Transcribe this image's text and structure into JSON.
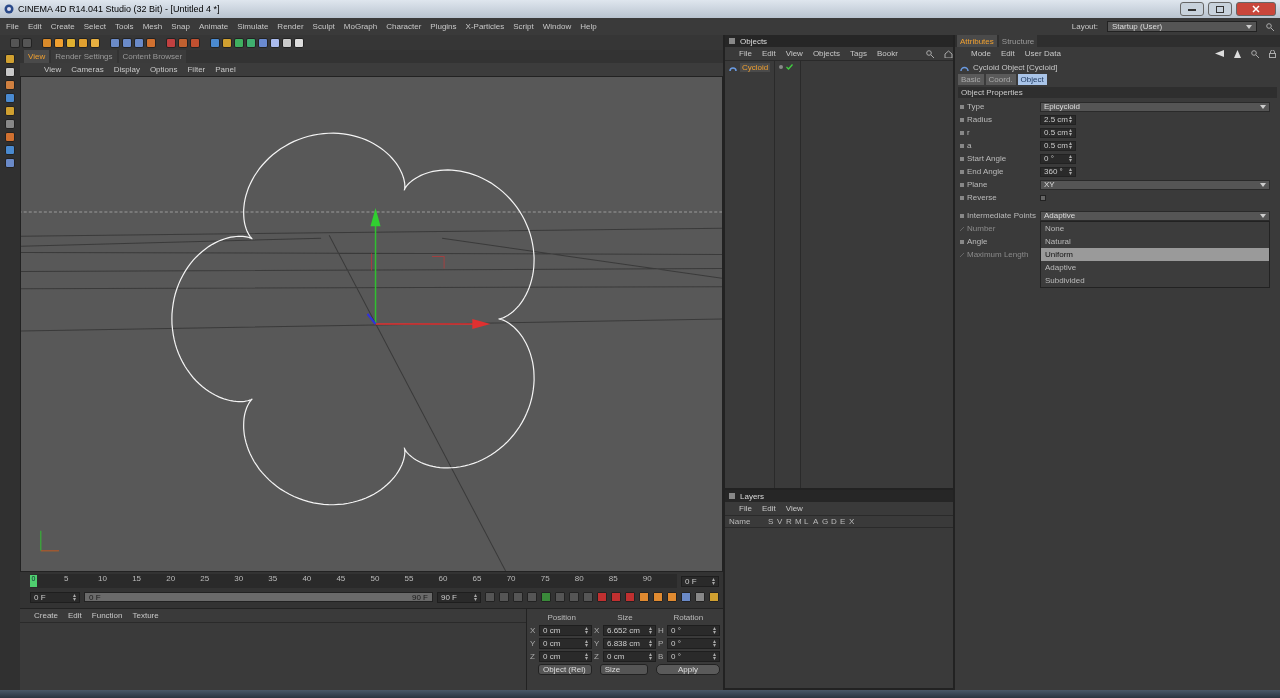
{
  "window": {
    "title": "CINEMA 4D R14.041 Studio (32 Bit) - [Untitled 4 *]"
  },
  "menu": [
    "File",
    "Edit",
    "Create",
    "Select",
    "Tools",
    "Mesh",
    "Snap",
    "Animate",
    "Simulate",
    "Render",
    "Sculpt",
    "MoGraph",
    "Character",
    "Plugins",
    "X-Particles",
    "Script",
    "Window",
    "Help"
  ],
  "layout": {
    "label": "Layout:",
    "value": "Startup (User)"
  },
  "viewport": {
    "tabs": [
      {
        "label": "View",
        "selected": true
      },
      {
        "label": "Render Settings",
        "selected": false
      },
      {
        "label": "Content Browser",
        "selected": false
      }
    ],
    "menu": [
      "View",
      "Cameras",
      "Display",
      "Options",
      "Filter",
      "Panel"
    ]
  },
  "timeline": {
    "playhead": {
      "label": "0",
      "level": 0
    },
    "ticks": [
      "5",
      "10",
      "15",
      "20",
      "25",
      "30",
      "35",
      "40",
      "45",
      "50",
      "55",
      "60",
      "65",
      "70",
      "75",
      "80",
      "85",
      "90"
    ],
    "current": "0 F",
    "start": "0 F",
    "range_start": "0 F",
    "range_end": "90 F",
    "end": "90 F"
  },
  "material_menu": [
    "Create",
    "Edit",
    "Function",
    "Texture"
  ],
  "coordinates": {
    "headers": [
      "Position",
      "Size",
      "Rotation"
    ],
    "rows": [
      {
        "axis": "X",
        "position": "0 cm",
        "size_axis": "X",
        "size": "6.652 cm",
        "rot_axis": "H",
        "rotation": "0 °"
      },
      {
        "axis": "Y",
        "position": "0 cm",
        "size_axis": "Y",
        "size": "6.838 cm",
        "rot_axis": "P",
        "rotation": "0 °"
      },
      {
        "axis": "Z",
        "position": "0 cm",
        "size_axis": "Z",
        "size": "0 cm",
        "rot_axis": "B",
        "rotation": "0 °"
      }
    ],
    "mode": "Object (Rel)",
    "size_mode": "Size",
    "apply": "Apply"
  },
  "objects": {
    "title": "Objects",
    "menu": [
      "File",
      "Edit",
      "View",
      "Objects",
      "Tags",
      "Bookr"
    ],
    "items": [
      {
        "name": "Cycloid",
        "selected": true
      }
    ]
  },
  "layers": {
    "title": "Layers",
    "menu": [
      "File",
      "Edit",
      "View"
    ],
    "columns": [
      "Name",
      "S",
      "V",
      "R",
      "M",
      "L",
      "A",
      "G",
      "D",
      "E",
      "X"
    ]
  },
  "attributes": {
    "tabs": [
      {
        "label": "Attributes",
        "selected": true
      },
      {
        "label": "Structure",
        "selected": false
      }
    ],
    "menu": [
      "Mode",
      "Edit",
      "User Data"
    ],
    "object_title": "Cycloid Object [Cycloid]",
    "subtabs": [
      {
        "label": "Basic",
        "selected": false
      },
      {
        "label": "Coord.",
        "selected": false
      },
      {
        "label": "Object",
        "selected": true
      }
    ],
    "section": "Object Properties",
    "properties": [
      {
        "label": "Type",
        "kind": "dropdown",
        "value": "Epicycloid",
        "disabled": false
      },
      {
        "label": "Radius",
        "kind": "number",
        "value": "2.5 cm",
        "disabled": false
      },
      {
        "label": "r",
        "kind": "number",
        "value": "0.5 cm",
        "disabled": false
      },
      {
        "label": "a",
        "kind": "number",
        "value": "0.5 cm",
        "disabled": false
      },
      {
        "label": "Start Angle",
        "kind": "number",
        "value": "0 °",
        "disabled": false
      },
      {
        "label": "End Angle",
        "kind": "number",
        "value": "360 °",
        "disabled": false
      },
      {
        "label": "Plane",
        "kind": "dropdown",
        "value": "XY",
        "disabled": false
      },
      {
        "label": "Reverse",
        "kind": "checkbox",
        "checked": false,
        "disabled": false
      },
      {
        "label": "Intermediate Points",
        "kind": "dropdown",
        "value": "Adaptive",
        "disabled": false,
        "options": [
          {
            "label": "None",
            "highlighted": false
          },
          {
            "label": "Natural",
            "highlighted": false
          },
          {
            "label": "Uniform",
            "highlighted": true
          },
          {
            "label": "Adaptive",
            "highlighted": false
          },
          {
            "label": "Subdivided",
            "highlighted": false
          }
        ]
      },
      {
        "label": "Number",
        "kind": "plain",
        "disabled": true
      },
      {
        "label": "Angle",
        "kind": "plain",
        "disabled": false
      },
      {
        "label": "Maximum Length",
        "kind": "plain",
        "disabled": true
      }
    ]
  }
}
